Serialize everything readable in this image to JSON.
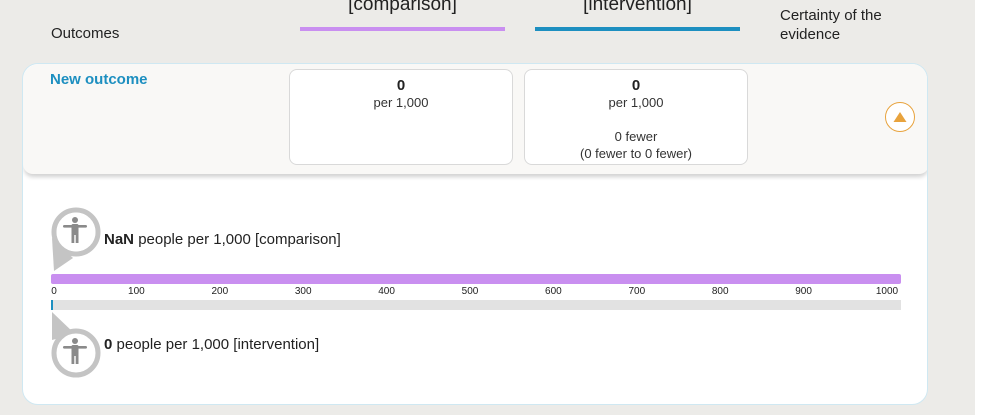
{
  "header": {
    "outcomes_label": "Outcomes",
    "comparison_label": "[comparison]",
    "intervention_label": "[intervention]",
    "certainty_label": "Certainty of the evidence"
  },
  "colors": {
    "comparison": "#c98ff0",
    "intervention": "#1d8fc0",
    "accent": "#e8a33d",
    "link": "#1d8fc0"
  },
  "outcome": {
    "name": "New outcome",
    "comparison": {
      "value": "0",
      "unit": "per 1,000"
    },
    "intervention": {
      "value": "0",
      "unit": "per 1,000",
      "difference": "0 fewer",
      "difference_range": "(0 fewer to 0 fewer)"
    },
    "collapse_icon": "triangle-up-icon"
  },
  "pictograph": {
    "comparison": {
      "value": "NaN",
      "text": "people per 1,000 [comparison]",
      "fill_fraction": 1.0
    },
    "intervention": {
      "value": "0",
      "text": "people per 1,000 [intervention]",
      "fill_fraction": 0.0
    },
    "scale_ticks": [
      "0",
      "100",
      "200",
      "300",
      "400",
      "500",
      "600",
      "700",
      "800",
      "900",
      "1000"
    ],
    "person_icon": "person-icon"
  }
}
